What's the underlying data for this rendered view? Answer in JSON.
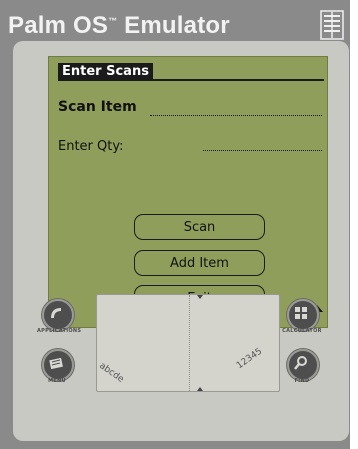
{
  "window": {
    "title": "Palm OS",
    "trademark": "™",
    "title_suffix": " Emulator",
    "menu_icon": "striped-grip-icon"
  },
  "form": {
    "title": "Enter Scans",
    "scan_item_label": "Scan Item",
    "scan_item_value": "",
    "qty_label": "Enter Qty:",
    "qty_value": ""
  },
  "buttons": {
    "scan": "Scan",
    "add_item": "Add Item",
    "exit": "Exit"
  },
  "scroll_indicator": "up-arrow-icon",
  "graffiti": {
    "left_hint": "abcde",
    "right_hint": "12345"
  },
  "silkscreen": {
    "applications": "APPLICATIONS",
    "menu": "MENU",
    "calculator": "CALCULATOR",
    "find": "FIND"
  },
  "colors": {
    "lcd": "#8f9f5b",
    "device": "#c9c9c3",
    "frame": "#8a8a8a"
  }
}
